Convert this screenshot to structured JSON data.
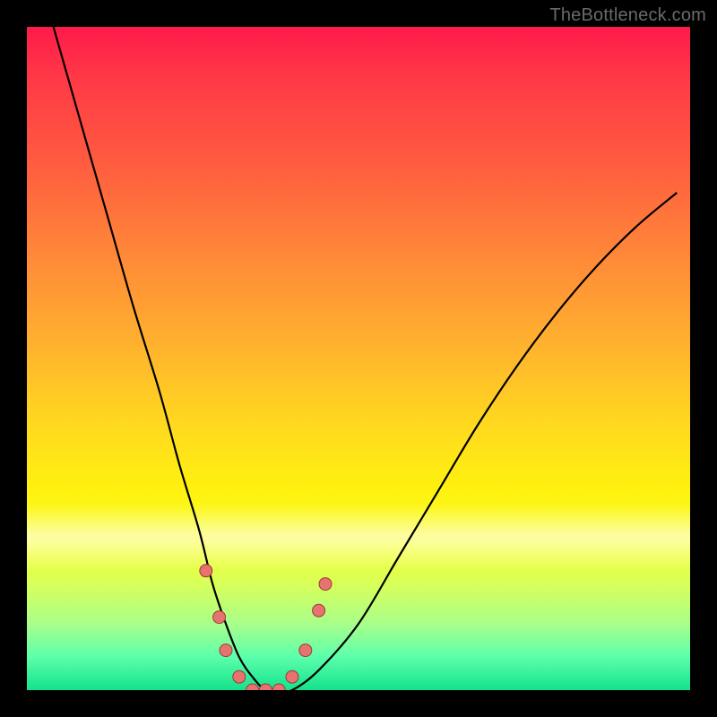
{
  "watermark": "TheBottleneck.com",
  "colors": {
    "gradient_top": "#ff1a4b",
    "gradient_mid": "#ffd91f",
    "gradient_bottom": "#14e28c",
    "curve": "#000000",
    "marker_fill": "#e6736f",
    "marker_stroke": "#9c3b37"
  },
  "chart_data": {
    "type": "line",
    "title": "",
    "xlabel": "",
    "ylabel": "",
    "xlim": [
      0,
      100
    ],
    "ylim": [
      0,
      100
    ],
    "note": "Figure shows a bottleneck-style curve on a rainbow heat background. No axes, ticks, or labels are rendered. X is approximate normalized horizontal position (0–100 across the colored panel). Y values are read off the vertical position where 0 is the bottom edge and 100 is the top edge of the colored panel. Markers represent the small dots along the curve near the valley.",
    "series": [
      {
        "name": "curve",
        "x": [
          4,
          8,
          12,
          16,
          20,
          23,
          26,
          28,
          30,
          32,
          34,
          36,
          38,
          40,
          44,
          50,
          56,
          62,
          68,
          74,
          80,
          86,
          92,
          98
        ],
        "y": [
          100,
          86,
          72,
          58,
          45,
          34,
          24,
          16,
          10,
          5,
          2,
          0,
          0,
          0,
          3,
          10,
          20,
          30,
          40,
          49,
          57,
          64,
          70,
          75
        ]
      }
    ],
    "markers": [
      {
        "x": 27,
        "y": 18
      },
      {
        "x": 29,
        "y": 11
      },
      {
        "x": 30,
        "y": 6
      },
      {
        "x": 32,
        "y": 2
      },
      {
        "x": 34,
        "y": 0
      },
      {
        "x": 36,
        "y": 0
      },
      {
        "x": 38,
        "y": 0
      },
      {
        "x": 40,
        "y": 2
      },
      {
        "x": 42,
        "y": 6
      },
      {
        "x": 44,
        "y": 12
      },
      {
        "x": 45,
        "y": 16
      }
    ]
  }
}
